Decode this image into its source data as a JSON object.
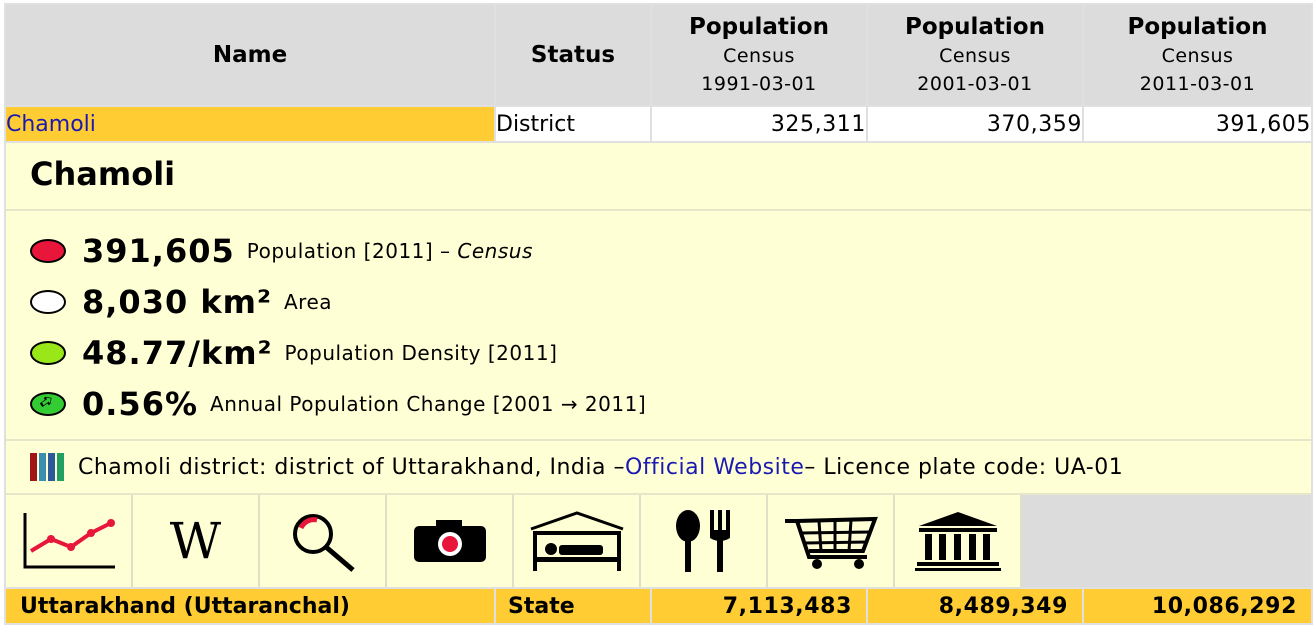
{
  "header": {
    "name": "Name",
    "status": "Status",
    "columns": [
      {
        "label": "Population",
        "sub": "Census",
        "date": "1991-03-01"
      },
      {
        "label": "Population",
        "sub": "Census",
        "date": "2001-03-01"
      },
      {
        "label": "Population",
        "sub": "Census",
        "date": "2011-03-01"
      }
    ]
  },
  "district_row": {
    "name": "Chamoli",
    "status": "District",
    "values": [
      "325,311",
      "370,359",
      "391,605"
    ]
  },
  "info": {
    "title": "Chamoli",
    "stats": [
      {
        "icon": "red-dot-icon",
        "value": "391,605",
        "label": "Population [2011] – ",
        "source": "Census"
      },
      {
        "icon": "white-dot-icon",
        "value": "8,030 km²",
        "label": "Area"
      },
      {
        "icon": "green-dot-icon",
        "value": "48.77/km²",
        "label": "Population Density [2011]"
      },
      {
        "icon": "growth-arrow-icon",
        "value": "0.56%",
        "label": "Annual Population Change [2001 → 2011]"
      }
    ],
    "description_pre": "Chamoli district: district of Uttarakhand, India – ",
    "website_link": "Official Website",
    "description_post": " – Licence plate code: UA-01",
    "colors": {
      "flag": [
        "#a01515",
        "#3a8fb0",
        "#2a5a9a",
        "#22a060"
      ],
      "highlight": "#ffcc33",
      "panel": "#ffffd6"
    }
  },
  "toolbar": {
    "icons": [
      "chart-icon",
      "wikipedia-icon",
      "search-icon",
      "camera-icon",
      "hotel-icon",
      "restaurant-icon",
      "shopping-cart-icon",
      "museum-icon"
    ],
    "wiki_letter": "W"
  },
  "state_row": {
    "name": "Uttarakhand (Uttaranchal)",
    "status": "State",
    "values": [
      "7,113,483",
      "8,489,349",
      "10,086,292"
    ]
  }
}
